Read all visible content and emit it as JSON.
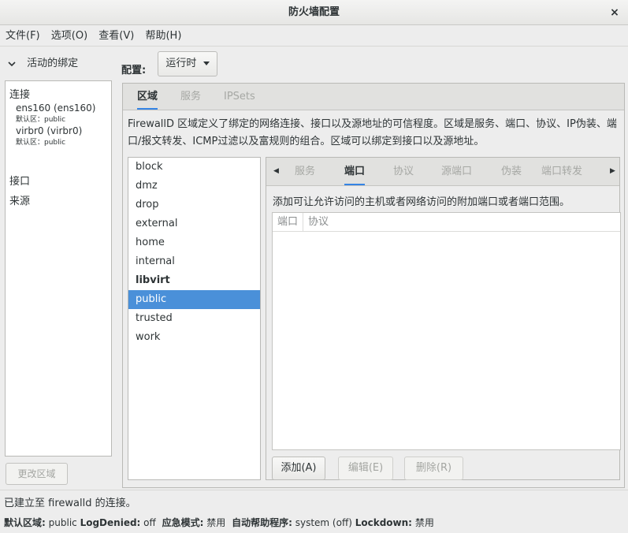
{
  "window": {
    "title": "防火墙配置",
    "close_glyph": "×"
  },
  "menubar": [
    "文件(F)",
    "选项(O)",
    "查看(V)",
    "帮助(H)"
  ],
  "left_panel": {
    "expander_label": "活动的绑定",
    "groups": {
      "connections": {
        "title": "连接",
        "items": [
          {
            "name": "ens160 (ens160)",
            "zone": "默认区：public"
          },
          {
            "name": "virbr0 (virbr0)",
            "zone": "默认区：public"
          }
        ]
      },
      "interfaces": {
        "title": "接口"
      },
      "sources": {
        "title": "来源"
      }
    },
    "change_zone_button": "更改区域"
  },
  "config": {
    "label": "配置:",
    "value": "运行时"
  },
  "top_tabs": [
    "区域",
    "服务",
    "IPSets"
  ],
  "zone_description": "FirewallD 区域定义了绑定的网络连接、接口以及源地址的可信程度。区域是服务、端口、协议、IP伪装、端口/报文转发、ICMP过滤以及富规则的组合。区域可以绑定到接口以及源地址。",
  "zones": [
    "block",
    "dmz",
    "drop",
    "external",
    "home",
    "internal",
    "libvirt",
    "public",
    "trusted",
    "work"
  ],
  "zone_selected": "public",
  "zone_bold": "libvirt",
  "sub_tabs": [
    "服务",
    "端口",
    "协议",
    "源端口",
    "伪装",
    "端口转发"
  ],
  "sub_tab_active": "端口",
  "ports": {
    "description": "添加可让允许访问的主机或者网络访问的附加端口或者端口范围。",
    "columns": [
      "端口",
      "协议"
    ],
    "rows": [],
    "buttons": {
      "add": "添加(A)",
      "edit": "编辑(E)",
      "remove": "删除(R)"
    }
  },
  "status": {
    "line1": "已建立至 firewalld 的连接。",
    "default_zone_label": "默认区域:",
    "default_zone_value": "public",
    "log_denied_label": "LogDenied:",
    "log_denied_value": "off",
    "panic_label": "应急模式:",
    "panic_value": "禁用",
    "helper_label": "自动帮助程序:",
    "helper_value": "system (off)",
    "lockdown_label": "Lockdown:",
    "lockdown_value": "禁用"
  }
}
